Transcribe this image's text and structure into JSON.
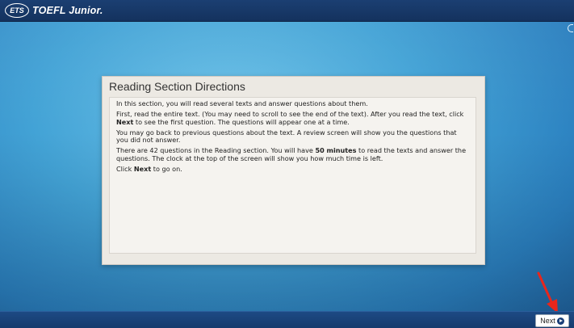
{
  "header": {
    "logo_mark": "ETS",
    "product_name": "TOEFL Junior."
  },
  "panel": {
    "title": "Reading Section Directions",
    "paragraphs": [
      {
        "text": "In this section, you will read several texts and answer questions about them."
      },
      {
        "pre": "First, read the entire text. (You may need to scroll to see the end of the text). After you read the text, click ",
        "bold": "Next",
        "post": " to see the first question. The questions will appear one at a time."
      },
      {
        "text": "You may go back to previous questions about the text. A review screen will show you the questions that you did not answer."
      },
      {
        "pre": "There are 42 questions in the Reading section. You will have ",
        "bold": "50 minutes",
        "post": " to read the texts and answer the questions. The clock at the top of the screen will show you how much time is left."
      },
      {
        "pre": "Click ",
        "bold": "Next",
        "post": " to go on."
      }
    ]
  },
  "footer": {
    "next_label": "Next",
    "next_icon": "circle-arrow-right-icon"
  },
  "annotation": {
    "arrow_color": "#e8261c"
  }
}
